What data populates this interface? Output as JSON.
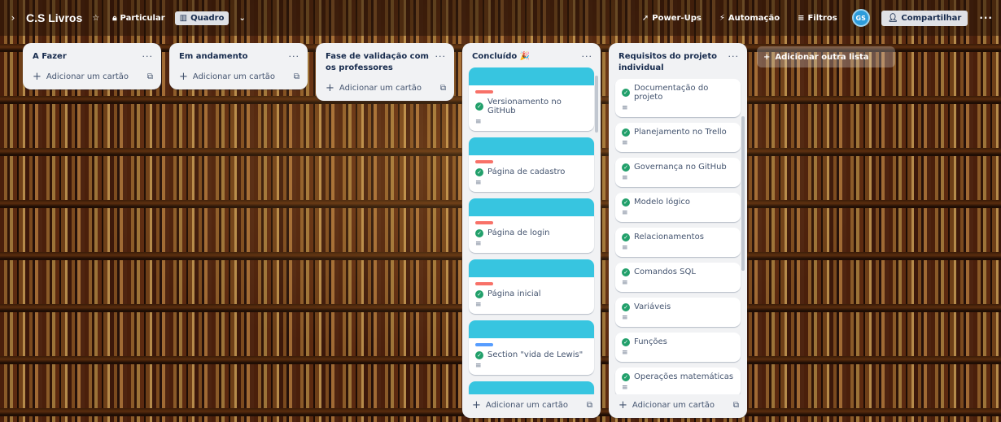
{
  "topbar": {
    "board_title": "C.S Livros",
    "visibility": "Particular",
    "view": "Quadro",
    "powerups": "Power-Ups",
    "automation": "Automação",
    "filters": "Filtros",
    "share": "Compartilhar",
    "avatar_initials": "GS"
  },
  "lists": [
    {
      "title": "A Fazer",
      "add_card": "Adicionar um cartão",
      "cards": []
    },
    {
      "title": "Em andamento",
      "add_card": "Adicionar um cartão",
      "cards": []
    },
    {
      "title": "Fase de validação com os professores",
      "add_card": "Adicionar um cartão",
      "cards": []
    },
    {
      "title": "Concluído 🎉",
      "add_card": "Adicionar um cartão",
      "cards": [
        {
          "title": "Versionamento no GitHub",
          "label_color": "#f87168",
          "cover_color": "#37c5e0"
        },
        {
          "title": "Página de cadastro",
          "label_color": "#f87168",
          "cover_color": "#37c5e0"
        },
        {
          "title": "Página de login",
          "label_color": "#f87168",
          "cover_color": "#37c5e0"
        },
        {
          "title": "Página inicial",
          "label_color": "#f87168",
          "cover_color": "#37c5e0"
        },
        {
          "title": "Section \"vida de Lewis\"",
          "label_color": "#579dff",
          "cover_color": "#37c5e0"
        }
      ]
    },
    {
      "title": "Requisitos do projeto individual",
      "add_card": "Adicionar um cartão",
      "cards": [
        {
          "title": "Documentação do projeto"
        },
        {
          "title": "Planejamento no Trello"
        },
        {
          "title": "Governança no GitHub"
        },
        {
          "title": "Modelo lógico"
        },
        {
          "title": "Relacionamentos"
        },
        {
          "title": "Comandos SQL"
        },
        {
          "title": "Variáveis"
        },
        {
          "title": "Funções"
        },
        {
          "title": "Operações matemáticas"
        }
      ]
    }
  ],
  "add_list": "Adicionar outra lista",
  "colors": {
    "cover": "#37c5e0",
    "label_red": "#f87168",
    "label_blue": "#579dff",
    "check_green": "#22a06b"
  }
}
